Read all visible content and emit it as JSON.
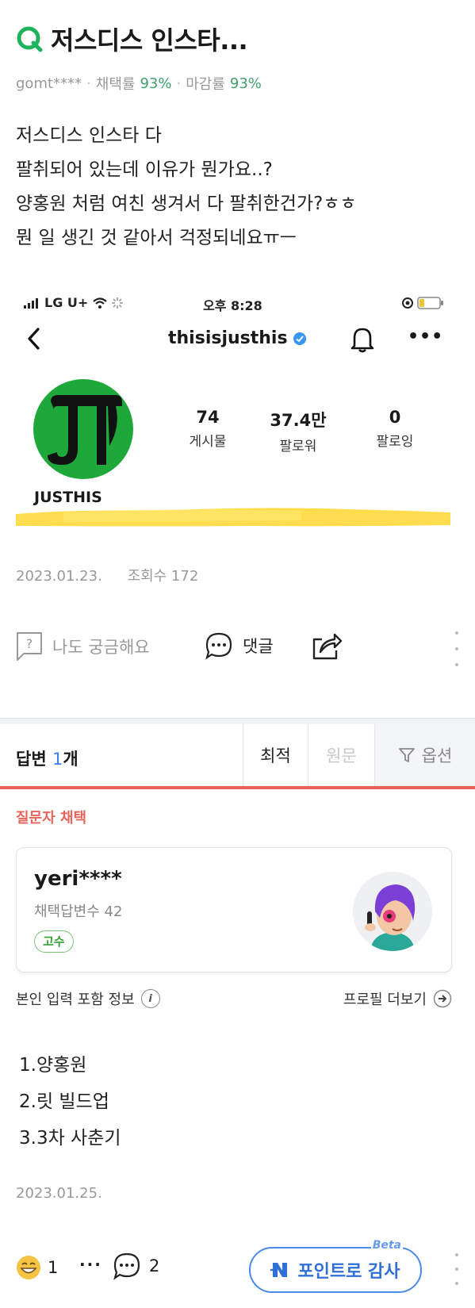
{
  "question": {
    "title": "저스디스 인스타...",
    "author": "gomt****",
    "adopt_label": "채택률",
    "adopt_rate": "93%",
    "close_label": "마감률",
    "close_rate": "93%",
    "body_lines": [
      "저스디스 인스타 다",
      "팔취되어 있는데 이유가 뭔가요..?",
      "양홍원 처럼 여친 생겨서 다 팔취한건가?ㅎㅎ",
      "뭔 일 생긴 것 같아서 걱정되네요ㅠㅡ"
    ],
    "date": "2023.01.23.",
    "views": "조회수 172"
  },
  "instagram": {
    "carrier": "LG U+",
    "time": "오후 8:28",
    "handle": "thisisjusthis",
    "avatar_letters": "JT",
    "posts": "74",
    "posts_label": "게시물",
    "followers": "37.4만",
    "followers_label": "팔로워",
    "following": "0",
    "following_label": "팔로잉",
    "name": "JUSTHIS"
  },
  "actions": {
    "curious": "나도 궁금해요",
    "comment": "댓글"
  },
  "answers_bar": {
    "label": "답변",
    "count": "1",
    "unit": "개",
    "best": "최적",
    "original": "원문",
    "options": "옵션"
  },
  "answer": {
    "chosen_label": "질문자 채택",
    "username": "yeri****",
    "adopt_count": "채택답변수 42",
    "badge": "고수",
    "info_label": "본인 입력 포함 정보",
    "profile_more": "프로필 더보기",
    "body_lines": [
      "1.양홍원",
      "2.릿 빌드업",
      "3.3차 사춘기"
    ],
    "date": "2023.01.25."
  },
  "footer": {
    "reaction_count": "1",
    "comment_count": "2",
    "thanks_label": "포인트로 감사",
    "beta": "Beta"
  },
  "colors": {
    "green": "#1fa83a",
    "accent_red": "#e8645a",
    "blue": "#3b7ff5"
  }
}
